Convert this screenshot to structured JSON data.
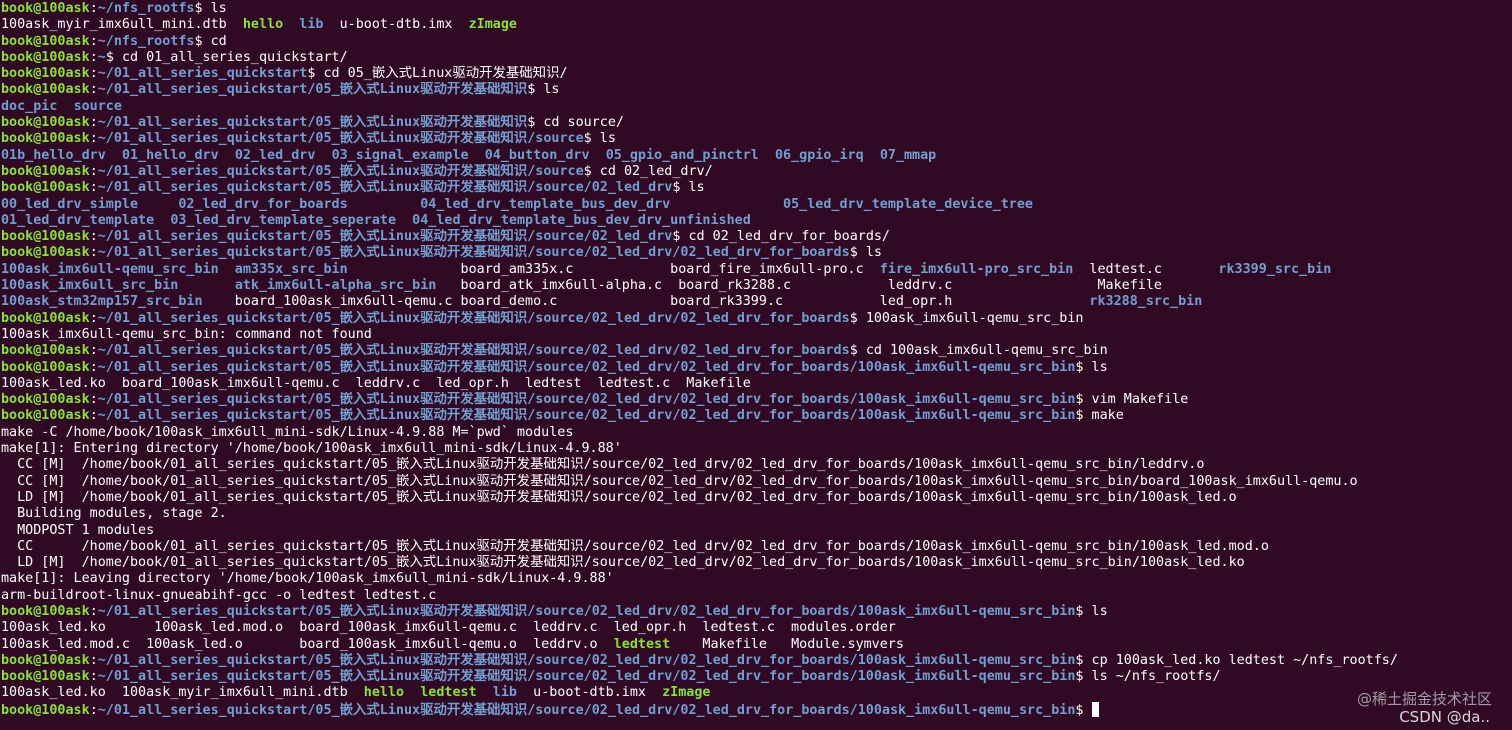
{
  "terminal": {
    "prompt_user": "book@100ask",
    "lines": [
      {
        "kind": "prompt",
        "path": "~/nfs_rootfs",
        "cmd": "ls"
      },
      {
        "kind": "output",
        "segments": [
          {
            "t": "100ask_myir_imx6ull_mini.dtb",
            "c": "file"
          },
          {
            "t": "  "
          },
          {
            "t": "hello",
            "c": "exe"
          },
          {
            "t": "  "
          },
          {
            "t": "lib",
            "c": "dir"
          },
          {
            "t": "  "
          },
          {
            "t": "u-boot-dtb.imx",
            "c": "file"
          },
          {
            "t": "  "
          },
          {
            "t": "zImage",
            "c": "exe"
          }
        ]
      },
      {
        "kind": "prompt",
        "path": "~/nfs_rootfs",
        "cmd": "cd"
      },
      {
        "kind": "prompt",
        "path": "~",
        "cmd": "cd 01_all_series_quickstart/"
      },
      {
        "kind": "prompt",
        "path": "~/01_all_series_quickstart",
        "cmd": "cd 05_嵌入式Linux驱动开发基础知识/"
      },
      {
        "kind": "prompt",
        "path": "~/01_all_series_quickstart/05_嵌入式Linux驱动开发基础知识",
        "cmd": "ls"
      },
      {
        "kind": "output",
        "segments": [
          {
            "t": "doc_pic",
            "c": "dir"
          },
          {
            "t": "  "
          },
          {
            "t": "source",
            "c": "dir"
          }
        ]
      },
      {
        "kind": "prompt",
        "path": "~/01_all_series_quickstart/05_嵌入式Linux驱动开发基础知识",
        "cmd": "cd source/"
      },
      {
        "kind": "prompt",
        "path": "~/01_all_series_quickstart/05_嵌入式Linux驱动开发基础知识/source",
        "cmd": "ls"
      },
      {
        "kind": "output",
        "segments": [
          {
            "t": "01b_hello_drv",
            "c": "dir"
          },
          {
            "t": "  "
          },
          {
            "t": "01_hello_drv",
            "c": "dir"
          },
          {
            "t": "  "
          },
          {
            "t": "02_led_drv",
            "c": "dir"
          },
          {
            "t": "  "
          },
          {
            "t": "03_signal_example",
            "c": "dir"
          },
          {
            "t": "  "
          },
          {
            "t": "04_button_drv",
            "c": "dir"
          },
          {
            "t": "  "
          },
          {
            "t": "05_gpio_and_pinctrl",
            "c": "dir"
          },
          {
            "t": "  "
          },
          {
            "t": "06_gpio_irq",
            "c": "dir"
          },
          {
            "t": "  "
          },
          {
            "t": "07_mmap",
            "c": "dir"
          }
        ]
      },
      {
        "kind": "prompt",
        "path": "~/01_all_series_quickstart/05_嵌入式Linux驱动开发基础知识/source",
        "cmd": "cd 02_led_drv/"
      },
      {
        "kind": "prompt",
        "path": "~/01_all_series_quickstart/05_嵌入式Linux驱动开发基础知识/source/02_led_drv",
        "cmd": "ls"
      },
      {
        "kind": "output",
        "segments": [
          {
            "t": "00_led_drv_simple",
            "c": "dir"
          },
          {
            "t": "     "
          },
          {
            "t": "02_led_drv_for_boards",
            "c": "dir"
          },
          {
            "t": "         "
          },
          {
            "t": "04_led_drv_template_bus_dev_drv",
            "c": "dir"
          },
          {
            "t": "              "
          },
          {
            "t": "05_led_drv_template_device_tree",
            "c": "dir"
          }
        ]
      },
      {
        "kind": "output",
        "segments": [
          {
            "t": "01_led_drv_template",
            "c": "dir"
          },
          {
            "t": "  "
          },
          {
            "t": "03_led_drv_template_seperate",
            "c": "dir"
          },
          {
            "t": "  "
          },
          {
            "t": "04_led_drv_template_bus_dev_drv_unfinished",
            "c": "dir"
          }
        ]
      },
      {
        "kind": "prompt",
        "path": "~/01_all_series_quickstart/05_嵌入式Linux驱动开发基础知识/source/02_led_drv",
        "cmd": "cd 02_led_drv_for_boards/"
      },
      {
        "kind": "prompt",
        "path": "~/01_all_series_quickstart/05_嵌入式Linux驱动开发基础知识/source/02_led_drv/02_led_drv_for_boards",
        "cmd": "ls"
      },
      {
        "kind": "output",
        "segments": [
          {
            "t": "100ask_imx6ull-qemu_src_bin",
            "c": "dir"
          },
          {
            "t": "  "
          },
          {
            "t": "am335x_src_bin",
            "c": "dir"
          },
          {
            "t": "              "
          },
          {
            "t": "board_am335x.c",
            "c": "file"
          },
          {
            "t": "            "
          },
          {
            "t": "board_fire_imx6ull-pro.c",
            "c": "file"
          },
          {
            "t": "  "
          },
          {
            "t": "fire_imx6ull-pro_src_bin",
            "c": "dir"
          },
          {
            "t": "  "
          },
          {
            "t": "ledtest.c",
            "c": "file"
          },
          {
            "t": "       "
          },
          {
            "t": "rk3399_src_bin",
            "c": "dir"
          }
        ]
      },
      {
        "kind": "output",
        "segments": [
          {
            "t": "100ask_imx6ull_src_bin",
            "c": "dir"
          },
          {
            "t": "       "
          },
          {
            "t": "atk_imx6ull-alpha_src_bin",
            "c": "dir"
          },
          {
            "t": "   "
          },
          {
            "t": "board_atk_imx6ull-alpha.c",
            "c": "file"
          },
          {
            "t": "  "
          },
          {
            "t": "board_rk3288.c",
            "c": "file"
          },
          {
            "t": "            "
          },
          {
            "t": "leddrv.c",
            "c": "file"
          },
          {
            "t": "                  "
          },
          {
            "t": "Makefile",
            "c": "file"
          }
        ]
      },
      {
        "kind": "output",
        "segments": [
          {
            "t": "100ask_stm32mp157_src_bin",
            "c": "dir"
          },
          {
            "t": "    "
          },
          {
            "t": "board_100ask_imx6ull-qemu.c",
            "c": "file"
          },
          {
            "t": " "
          },
          {
            "t": "board_demo.c",
            "c": "file"
          },
          {
            "t": "              "
          },
          {
            "t": "board_rk3399.c",
            "c": "file"
          },
          {
            "t": "            "
          },
          {
            "t": "led_opr.h",
            "c": "file"
          },
          {
            "t": "                 "
          },
          {
            "t": "rk3288_src_bin",
            "c": "dir"
          }
        ]
      },
      {
        "kind": "prompt",
        "path": "~/01_all_series_quickstart/05_嵌入式Linux驱动开发基础知识/source/02_led_drv/02_led_drv_for_boards",
        "cmd": "100ask_imx6ull-qemu_src_bin"
      },
      {
        "kind": "output",
        "segments": [
          {
            "t": "100ask_imx6ull-qemu_src_bin: command not found",
            "c": "file"
          }
        ]
      },
      {
        "kind": "prompt",
        "path": "~/01_all_series_quickstart/05_嵌入式Linux驱动开发基础知识/source/02_led_drv/02_led_drv_for_boards",
        "cmd": "cd 100ask_imx6ull-qemu_src_bin"
      },
      {
        "kind": "prompt",
        "path": "~/01_all_series_quickstart/05_嵌入式Linux驱动开发基础知识/source/02_led_drv/02_led_drv_for_boards/100ask_imx6ull-qemu_src_bin",
        "cmd": "ls"
      },
      {
        "kind": "output",
        "segments": [
          {
            "t": "100ask_led.ko  board_100ask_imx6ull-qemu.c  leddrv.c  led_opr.h  ledtest  ledtest.c  Makefile",
            "c": "file"
          }
        ]
      },
      {
        "kind": "prompt",
        "path": "~/01_all_series_quickstart/05_嵌入式Linux驱动开发基础知识/source/02_led_drv/02_led_drv_for_boards/100ask_imx6ull-qemu_src_bin",
        "cmd": "vim Makefile"
      },
      {
        "kind": "prompt",
        "path": "~/01_all_series_quickstart/05_嵌入式Linux驱动开发基础知识/source/02_led_drv/02_led_drv_for_boards/100ask_imx6ull-qemu_src_bin",
        "cmd": "make"
      },
      {
        "kind": "output",
        "segments": [
          {
            "t": "make -C /home/book/100ask_imx6ull_mini-sdk/Linux-4.9.88 M=`pwd` modules",
            "c": "file"
          }
        ]
      },
      {
        "kind": "output",
        "segments": [
          {
            "t": "make[1]: Entering directory '/home/book/100ask_imx6ull_mini-sdk/Linux-4.9.88'",
            "c": "file"
          }
        ]
      },
      {
        "kind": "output",
        "segments": [
          {
            "t": "  CC [M]  /home/book/01_all_series_quickstart/05_嵌入式Linux驱动开发基础知识/source/02_led_drv/02_led_drv_for_boards/100ask_imx6ull-qemu_src_bin/leddrv.o",
            "c": "file"
          }
        ]
      },
      {
        "kind": "output",
        "segments": [
          {
            "t": "  CC [M]  /home/book/01_all_series_quickstart/05_嵌入式Linux驱动开发基础知识/source/02_led_drv/02_led_drv_for_boards/100ask_imx6ull-qemu_src_bin/board_100ask_imx6ull-qemu.o",
            "c": "file"
          }
        ]
      },
      {
        "kind": "output",
        "segments": [
          {
            "t": "  LD [M]  /home/book/01_all_series_quickstart/05_嵌入式Linux驱动开发基础知识/source/02_led_drv/02_led_drv_for_boards/100ask_imx6ull-qemu_src_bin/100ask_led.o",
            "c": "file"
          }
        ]
      },
      {
        "kind": "output",
        "segments": [
          {
            "t": "  Building modules, stage 2.",
            "c": "file"
          }
        ]
      },
      {
        "kind": "output",
        "segments": [
          {
            "t": "  MODPOST 1 modules",
            "c": "file"
          }
        ]
      },
      {
        "kind": "output",
        "segments": [
          {
            "t": "  CC      /home/book/01_all_series_quickstart/05_嵌入式Linux驱动开发基础知识/source/02_led_drv/02_led_drv_for_boards/100ask_imx6ull-qemu_src_bin/100ask_led.mod.o",
            "c": "file"
          }
        ]
      },
      {
        "kind": "output",
        "segments": [
          {
            "t": "  LD [M]  /home/book/01_all_series_quickstart/05_嵌入式Linux驱动开发基础知识/source/02_led_drv/02_led_drv_for_boards/100ask_imx6ull-qemu_src_bin/100ask_led.ko",
            "c": "file"
          }
        ]
      },
      {
        "kind": "output",
        "segments": [
          {
            "t": "make[1]: Leaving directory '/home/book/100ask_imx6ull_mini-sdk/Linux-4.9.88'",
            "c": "file"
          }
        ]
      },
      {
        "kind": "output",
        "segments": [
          {
            "t": "arm-buildroot-linux-gnueabihf-gcc -o ledtest ledtest.c",
            "c": "file"
          }
        ]
      },
      {
        "kind": "prompt",
        "path": "~/01_all_series_quickstart/05_嵌入式Linux驱动开发基础知识/source/02_led_drv/02_led_drv_for_boards/100ask_imx6ull-qemu_src_bin",
        "cmd": "ls"
      },
      {
        "kind": "output",
        "segments": [
          {
            "t": "100ask_led.ko      100ask_led.mod.o  board_100ask_imx6ull-qemu.c  leddrv.c  led_opr.h  ledtest.c  modules.order",
            "c": "file"
          }
        ]
      },
      {
        "kind": "output",
        "segments": [
          {
            "t": "100ask_led.mod.c  100ask_led.o       board_100ask_imx6ull-qemu.o  leddrv.o  ",
            "c": "file"
          },
          {
            "t": "ledtest",
            "c": "exe"
          },
          {
            "t": "    Makefile   Module.symvers",
            "c": "file"
          }
        ]
      },
      {
        "kind": "prompt",
        "path": "~/01_all_series_quickstart/05_嵌入式Linux驱动开发基础知识/source/02_led_drv/02_led_drv_for_boards/100ask_imx6ull-qemu_src_bin",
        "cmd": "cp 100ask_led.ko ledtest ~/nfs_rootfs/"
      },
      {
        "kind": "prompt",
        "path": "~/01_all_series_quickstart/05_嵌入式Linux驱动开发基础知识/source/02_led_drv/02_led_drv_for_boards/100ask_imx6ull-qemu_src_bin",
        "cmd": "ls ~/nfs_rootfs/"
      },
      {
        "kind": "output",
        "segments": [
          {
            "t": "100ask_led.ko  100ask_myir_imx6ull_mini.dtb  ",
            "c": "file"
          },
          {
            "t": "hello",
            "c": "exe"
          },
          {
            "t": "  "
          },
          {
            "t": "ledtest",
            "c": "exe"
          },
          {
            "t": "  "
          },
          {
            "t": "lib",
            "c": "dir"
          },
          {
            "t": "  "
          },
          {
            "t": "u-boot-dtb.imx",
            "c": "file"
          },
          {
            "t": "  "
          },
          {
            "t": "zImage",
            "c": "exe"
          }
        ]
      },
      {
        "kind": "prompt",
        "path": "~/01_all_series_quickstart/05_嵌入式Linux驱动开发基础知识/source/02_led_drv/02_led_drv_for_boards/100ask_imx6ull-qemu_src_bin",
        "cmd": "",
        "cursor": true
      }
    ]
  },
  "watermark": {
    "line1": "@稀土掘金技术社区",
    "line2": "CSDN @da.."
  },
  "colors": {
    "background": "#300a24",
    "prompt_user": "#8ae234",
    "path": "#729fcf",
    "directory": "#729fcf",
    "executable": "#8ae234",
    "text": "#ffffff"
  }
}
